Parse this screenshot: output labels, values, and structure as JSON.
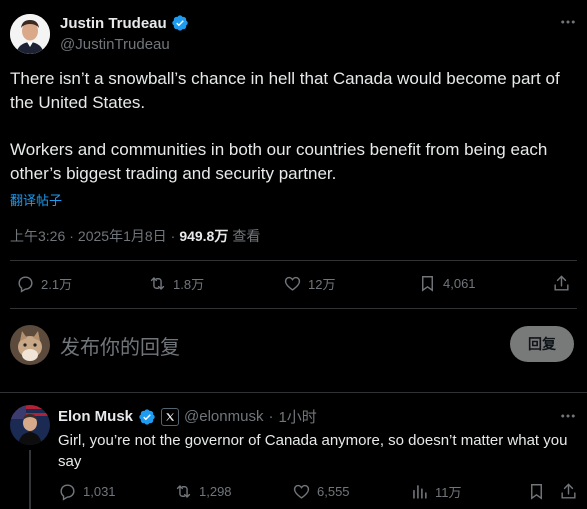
{
  "tweet": {
    "author_name": "Justin Trudeau",
    "author_handle": "@JustinTrudeau",
    "paragraph1": "There isn’t a snowball’s chance in hell that Canada would become part of the United States.",
    "paragraph2": "Workers and communities in both our countries benefit from being each other’s biggest trading and security partner.",
    "translate_label": "翻译帖子",
    "time": "上午3:26",
    "date": "2025年1月8日",
    "views_count": "949.8万",
    "views_label": "查看",
    "replies": "2.1万",
    "retweets": "1.8万",
    "likes": "12万",
    "bookmarks": "4,061"
  },
  "compose": {
    "placeholder": "发布你的回复",
    "reply_button": "回复"
  },
  "reply": {
    "author_name": "Elon Musk",
    "author_handle": "@elonmusk",
    "time": "1小时",
    "text": "Girl, you’re not the governor of Canada anymore, so doesn’t matter what you say",
    "replies": "1,031",
    "retweets": "1,298",
    "likes": "6,555",
    "views": "11万"
  },
  "colors": {
    "background": "#000000",
    "text": "#e7e9ea",
    "muted": "#71767b",
    "link": "#1d9bf0",
    "verified": "#1d9bf0",
    "divider": "#2f3336"
  },
  "icons": [
    "verified-badge-icon",
    "more-icon",
    "reply-icon",
    "retweet-icon",
    "like-icon",
    "bookmark-icon",
    "share-icon",
    "views-icon",
    "x-logo-icon"
  ]
}
